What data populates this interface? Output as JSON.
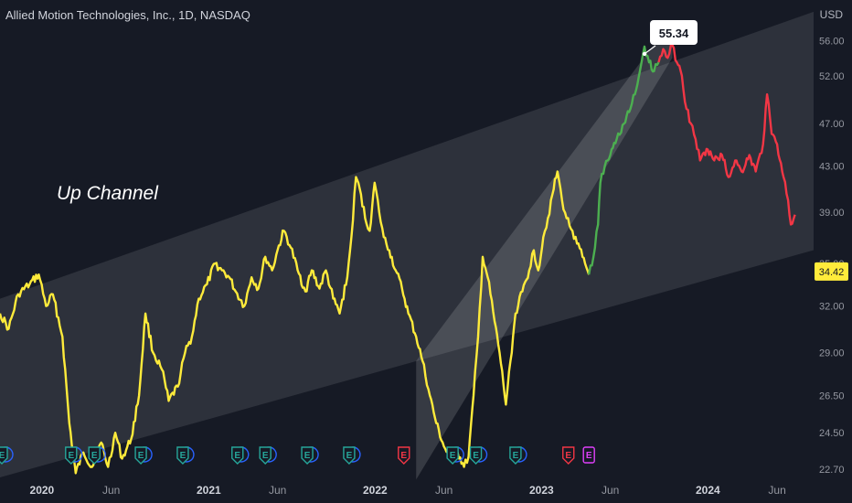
{
  "header": {
    "title": "Allied Motion Technologies, Inc., 1D, NASDAQ",
    "currency": "USD"
  },
  "annotations": {
    "pattern_label": "Up Channel",
    "peak_callout": "55.34",
    "last_price": "34.42"
  },
  "colors": {
    "background": "#161a25",
    "price_main": "#ffeb3b",
    "price_up": "#4caf50",
    "price_down": "#f23645",
    "channel_fill": "#ffffff",
    "last_price_badge": "#ffeb3b",
    "earnings_green": "#26a69a",
    "earnings_blue": "#2962ff",
    "earnings_red": "#f23645",
    "earnings_purple": "#e040fb"
  },
  "chart_data": {
    "type": "line",
    "title": "Allied Motion Technologies, Inc., 1D, NASDAQ",
    "y_unit": "USD",
    "y_axis_scale": "log",
    "ylim": [
      22.3,
      61
    ],
    "xlim": [
      "2019-10-01",
      "2024-08-20"
    ],
    "y_ticks": [
      "22.70",
      "24.50",
      "26.50",
      "29.00",
      "32.00",
      "35.00",
      "39.00",
      "43.00",
      "47.00",
      "52.00",
      "56.00"
    ],
    "x_ticks": [
      {
        "label": "2020",
        "date": "2020-01-01",
        "bold": true
      },
      {
        "label": "Jun",
        "date": "2020-06-01",
        "bold": false
      },
      {
        "label": "2021",
        "date": "2021-01-01",
        "bold": true
      },
      {
        "label": "Jun",
        "date": "2021-06-01",
        "bold": false
      },
      {
        "label": "2022",
        "date": "2022-01-01",
        "bold": true
      },
      {
        "label": "Jun",
        "date": "2022-06-01",
        "bold": false
      },
      {
        "label": "2023",
        "date": "2023-01-01",
        "bold": true
      },
      {
        "label": "Jun",
        "date": "2023-06-01",
        "bold": false
      },
      {
        "label": "2024",
        "date": "2024-01-01",
        "bold": true
      },
      {
        "label": "Jun",
        "date": "2024-06-01",
        "bold": false
      }
    ],
    "grid": false,
    "series": [
      {
        "color": "#ffeb3b",
        "points": [
          [
            "2019-10-01",
            31.5
          ],
          [
            "2019-10-20",
            30.5
          ],
          [
            "2019-11-10",
            32.8
          ],
          [
            "2019-12-05",
            33.5
          ],
          [
            "2019-12-25",
            34.2
          ],
          [
            "2020-01-10",
            32.0
          ],
          [
            "2020-01-25",
            32.8
          ],
          [
            "2020-02-15",
            30.0
          ],
          [
            "2020-03-01",
            25.0
          ],
          [
            "2020-03-15",
            22.5
          ],
          [
            "2020-04-01",
            23.5
          ],
          [
            "2020-04-20",
            22.8
          ],
          [
            "2020-05-10",
            24.0
          ],
          [
            "2020-05-25",
            22.8
          ],
          [
            "2020-06-10",
            24.5
          ],
          [
            "2020-06-25",
            23.2
          ],
          [
            "2020-07-15",
            24.2
          ],
          [
            "2020-08-01",
            26.5
          ],
          [
            "2020-08-15",
            31.5
          ],
          [
            "2020-09-01",
            29.0
          ],
          [
            "2020-09-20",
            28.0
          ],
          [
            "2020-10-05",
            26.2
          ],
          [
            "2020-10-25",
            27.0
          ],
          [
            "2020-11-10",
            29.0
          ],
          [
            "2020-11-25",
            30.0
          ],
          [
            "2020-12-10",
            32.5
          ],
          [
            "2020-12-28",
            33.5
          ],
          [
            "2021-01-15",
            35.0
          ],
          [
            "2021-01-30",
            34.5
          ],
          [
            "2021-02-15",
            34.0
          ],
          [
            "2021-03-01",
            33.0
          ],
          [
            "2021-03-20",
            32.0
          ],
          [
            "2021-04-05",
            34.0
          ],
          [
            "2021-04-20",
            33.2
          ],
          [
            "2021-05-05",
            35.5
          ],
          [
            "2021-05-20",
            34.5
          ],
          [
            "2021-06-01",
            36.0
          ],
          [
            "2021-06-15",
            37.5
          ],
          [
            "2021-06-30",
            36.2
          ],
          [
            "2021-07-15",
            34.5
          ],
          [
            "2021-08-01",
            33.0
          ],
          [
            "2021-08-15",
            34.5
          ],
          [
            "2021-09-01",
            33.2
          ],
          [
            "2021-09-15",
            34.5
          ],
          [
            "2021-10-01",
            32.5
          ],
          [
            "2021-10-15",
            31.5
          ],
          [
            "2021-11-01",
            34.0
          ],
          [
            "2021-11-10",
            37.0
          ],
          [
            "2021-11-20",
            42.0
          ],
          [
            "2021-12-01",
            40.5
          ],
          [
            "2021-12-10",
            38.5
          ],
          [
            "2021-12-20",
            37.5
          ],
          [
            "2021-12-31",
            41.5
          ],
          [
            "2022-01-10",
            39.0
          ],
          [
            "2022-01-20",
            37.0
          ],
          [
            "2022-02-01",
            36.0
          ],
          [
            "2022-02-15",
            34.5
          ],
          [
            "2022-03-01",
            33.2
          ],
          [
            "2022-03-15",
            31.5
          ],
          [
            "2022-04-01",
            30.0
          ],
          [
            "2022-04-15",
            28.5
          ],
          [
            "2022-05-01",
            26.5
          ],
          [
            "2022-05-15",
            25.0
          ],
          [
            "2022-06-01",
            23.8
          ],
          [
            "2022-06-15",
            23.2
          ],
          [
            "2022-07-01",
            23.5
          ],
          [
            "2022-07-15",
            22.8
          ],
          [
            "2022-07-25",
            23.3
          ],
          [
            "2022-08-05",
            26.5
          ],
          [
            "2022-08-15",
            30.0
          ],
          [
            "2022-08-25",
            35.5
          ],
          [
            "2022-09-05",
            34.0
          ],
          [
            "2022-09-20",
            31.0
          ],
          [
            "2022-10-01",
            29.0
          ],
          [
            "2022-10-15",
            26.0
          ],
          [
            "2022-10-25",
            28.5
          ],
          [
            "2022-11-05",
            31.5
          ],
          [
            "2022-11-20",
            33.0
          ],
          [
            "2022-12-05",
            34.5
          ],
          [
            "2022-12-15",
            36.0
          ],
          [
            "2022-12-25",
            34.5
          ],
          [
            "2023-01-05",
            37.0
          ],
          [
            "2023-01-15",
            38.5
          ],
          [
            "2023-01-25",
            40.5
          ],
          [
            "2023-02-05",
            42.5
          ],
          [
            "2023-02-15",
            40.0
          ],
          [
            "2023-02-25",
            38.5
          ],
          [
            "2023-03-10",
            37.5
          ],
          [
            "2023-03-20",
            36.5
          ],
          [
            "2023-04-01",
            35.5
          ],
          [
            "2023-04-15",
            34.2
          ]
        ]
      },
      {
        "color": "#4caf50",
        "points": [
          [
            "2023-04-15",
            34.2
          ],
          [
            "2023-04-25",
            35.5
          ],
          [
            "2023-05-05",
            38.0
          ],
          [
            "2023-05-10",
            41.5
          ],
          [
            "2023-05-20",
            43.0
          ],
          [
            "2023-06-01",
            44.0
          ],
          [
            "2023-06-15",
            45.5
          ],
          [
            "2023-07-01",
            47.0
          ],
          [
            "2023-07-15",
            48.5
          ],
          [
            "2023-07-25",
            50.0
          ],
          [
            "2023-08-05",
            52.5
          ],
          [
            "2023-08-15",
            55.3
          ],
          [
            "2023-08-25",
            53.5
          ],
          [
            "2023-09-05",
            52.5
          ],
          [
            "2023-09-15",
            53.5
          ]
        ]
      },
      {
        "color": "#f23645",
        "points": [
          [
            "2023-09-15",
            53.5
          ],
          [
            "2023-09-25",
            55.0
          ],
          [
            "2023-10-05",
            54.0
          ],
          [
            "2023-10-15",
            55.5
          ],
          [
            "2023-10-25",
            53.5
          ],
          [
            "2023-11-05",
            52.0
          ],
          [
            "2023-11-15",
            48.5
          ],
          [
            "2023-11-25",
            47.0
          ],
          [
            "2023-12-05",
            45.5
          ],
          [
            "2023-12-15",
            43.5
          ],
          [
            "2024-01-01",
            44.5
          ],
          [
            "2024-01-15",
            43.5
          ],
          [
            "2024-02-01",
            44.0
          ],
          [
            "2024-02-15",
            42.0
          ],
          [
            "2024-03-01",
            43.5
          ],
          [
            "2024-03-15",
            42.5
          ],
          [
            "2024-04-01",
            44.0
          ],
          [
            "2024-04-15",
            42.5
          ],
          [
            "2024-05-01",
            45.0
          ],
          [
            "2024-05-10",
            50.0
          ],
          [
            "2024-05-20",
            46.0
          ],
          [
            "2024-06-01",
            45.0
          ],
          [
            "2024-06-15",
            42.0
          ],
          [
            "2024-06-25",
            40.0
          ],
          [
            "2024-07-01",
            38.0
          ],
          [
            "2024-07-10",
            38.8
          ]
        ]
      }
    ],
    "drawings": {
      "up_channel": {
        "upper_start": [
          "2019-10-01",
          32.5
        ],
        "upper_end": [
          "2024-08-20",
          59.5
        ],
        "lower_start": [
          "2019-10-01",
          22.3
        ],
        "lower_end": [
          "2024-08-20",
          36.0
        ]
      },
      "inner_channel": {
        "lower_start": [
          "2022-04-01",
          22.2
        ],
        "lower_end": [
          "2023-10-15",
          54.0
        ],
        "upper_start": [
          "2022-04-01",
          28.5
        ],
        "upper_end": [
          "2023-10-15",
          58.5
        ]
      }
    },
    "earnings_markers": [
      {
        "date": "2019-10-05",
        "label": "E",
        "type": "green"
      },
      {
        "date": "2020-03-05",
        "label": "E",
        "type": "green"
      },
      {
        "date": "2020-04-25",
        "label": "E",
        "type": "green"
      },
      {
        "date": "2020-08-05",
        "label": "E",
        "type": "green"
      },
      {
        "date": "2020-11-05",
        "label": "E",
        "type": "green"
      },
      {
        "date": "2021-03-05",
        "label": "E",
        "type": "green"
      },
      {
        "date": "2021-05-05",
        "label": "E",
        "type": "green"
      },
      {
        "date": "2021-08-05",
        "label": "E",
        "type": "green"
      },
      {
        "date": "2021-11-05",
        "label": "E",
        "type": "green"
      },
      {
        "date": "2022-03-05",
        "label": "E",
        "type": "red"
      },
      {
        "date": "2022-06-20",
        "label": "E",
        "type": "green"
      },
      {
        "date": "2022-08-10",
        "label": "E",
        "type": "green"
      },
      {
        "date": "2022-11-05",
        "label": "E",
        "type": "green"
      },
      {
        "date": "2023-03-01",
        "label": "E",
        "type": "red"
      },
      {
        "date": "2023-04-15",
        "label": "E",
        "type": "purple"
      }
    ]
  }
}
